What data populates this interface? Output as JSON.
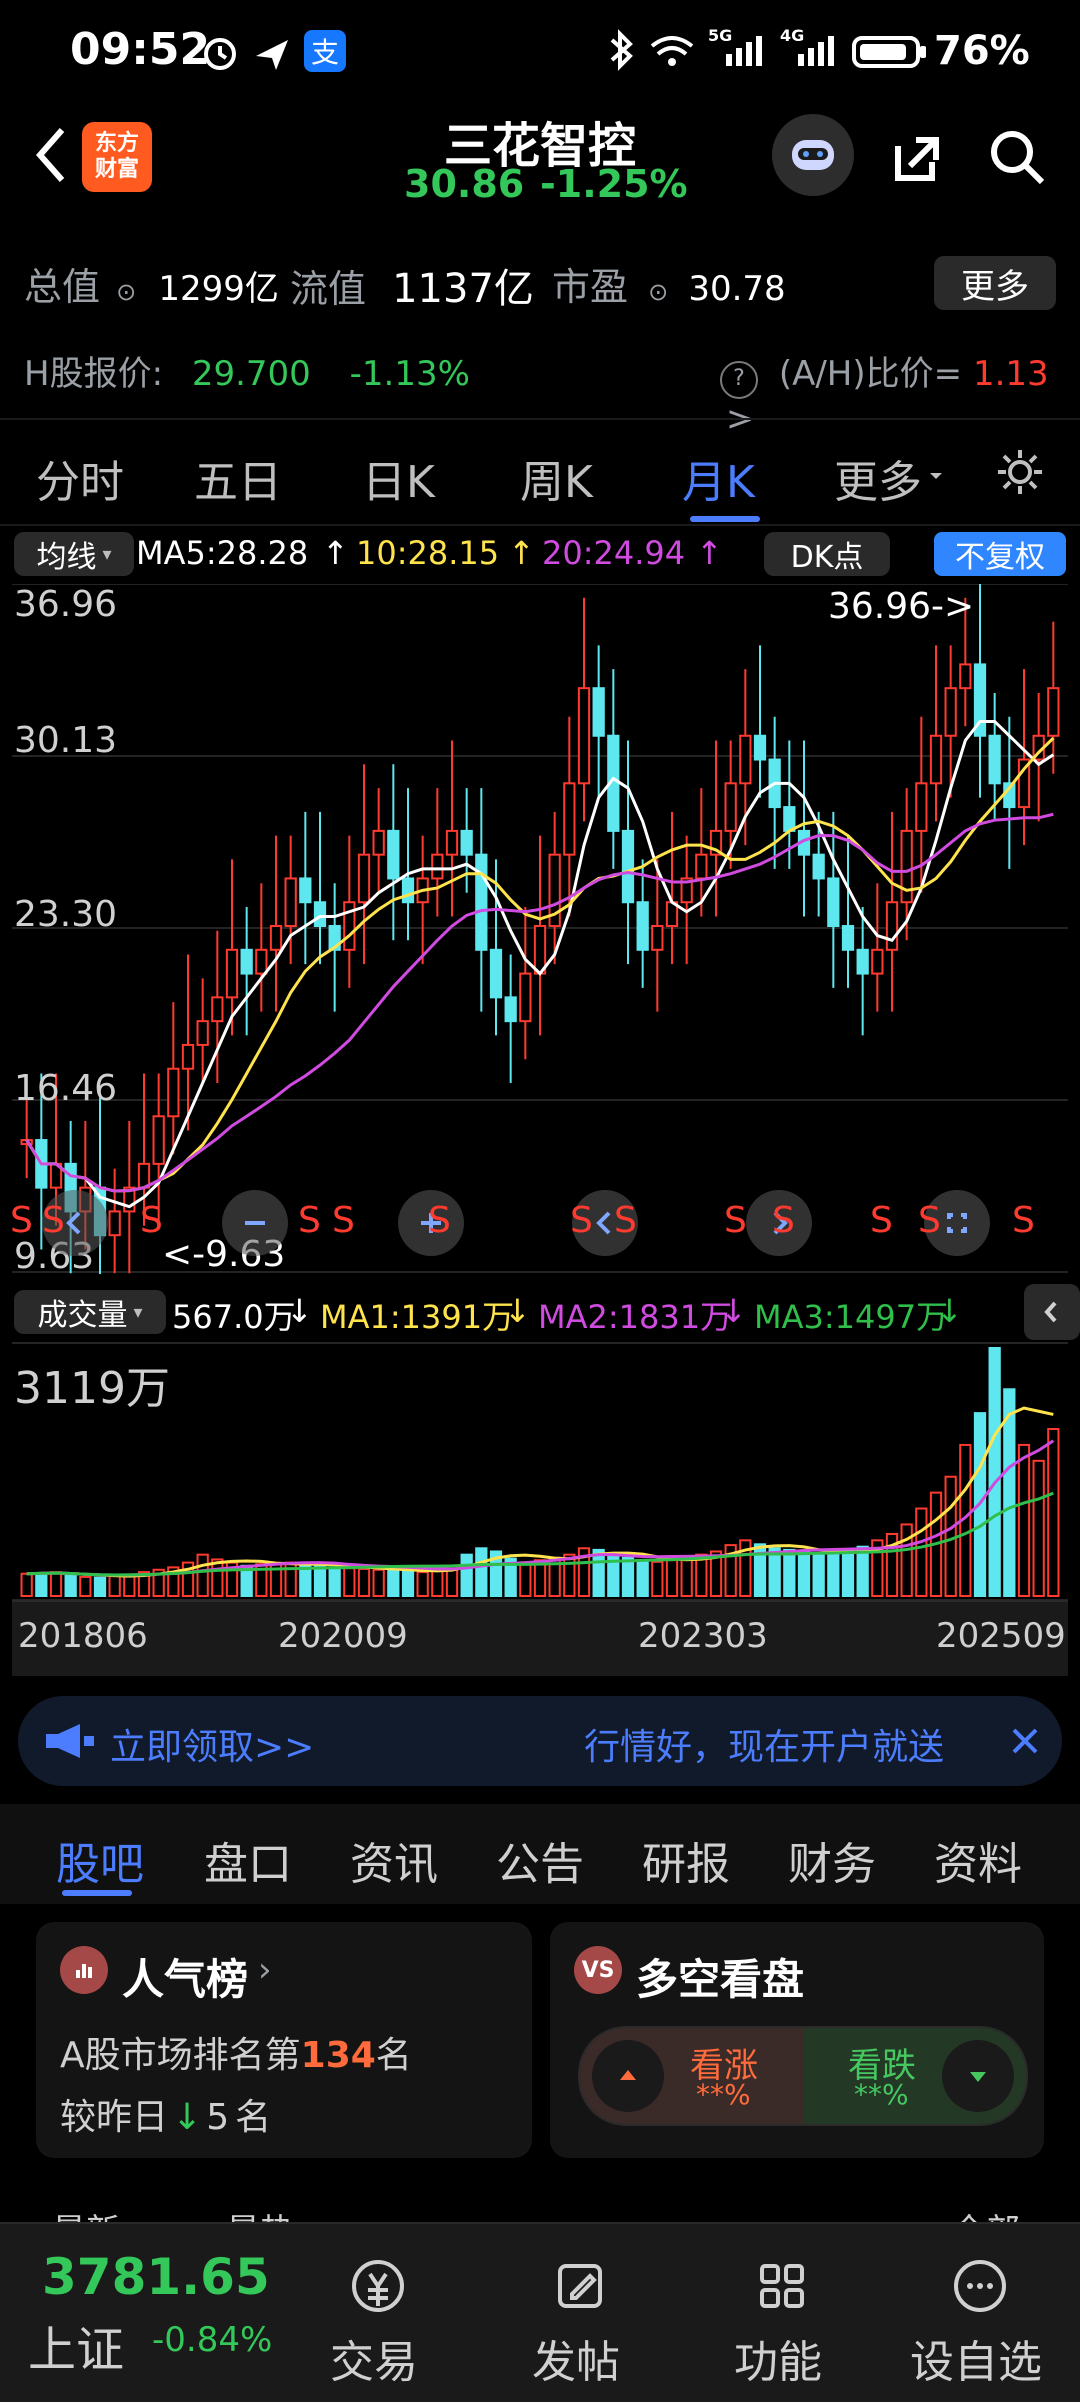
{
  "status_bar": {
    "time": "09:52",
    "battery": "76%",
    "net1": "5G",
    "net2": "4G"
  },
  "header": {
    "app_logo": "东方\n财富",
    "stock_name": "三花智控",
    "price": "30.86",
    "change_pct": "-1.25%"
  },
  "stats": {
    "total_value_label": "总值",
    "total_value": "1299亿",
    "float_value_label": "流值",
    "float_value": "1137亿",
    "pe_label": "市盈",
    "pe_value": "30.78",
    "more_label": "更多",
    "h_label": "H股报价:",
    "h_price": "29.700",
    "h_change": "-1.13%",
    "ah_label": "(A/H)比价=",
    "ah_value": "1.13"
  },
  "tabs": {
    "items": [
      "分时",
      "五日",
      "日K",
      "周K",
      "月K",
      "更多"
    ],
    "active_index": 4
  },
  "ma_row": {
    "btn": "均线",
    "ma5": "MA5:28.28",
    "ma10": "10:28.15",
    "ma20": "20:24.94",
    "dk": "DK点",
    "adj": "不复权"
  },
  "chart_main": {
    "y_ticks": [
      "36.96",
      "30.13",
      "23.30",
      "16.46",
      "9.63"
    ],
    "high_annotation": "36.96->",
    "low_annotation": "<-9.63"
  },
  "vol_row": {
    "btn": "成交量",
    "vol": "567.0万",
    "ma1": "MA1:1391万",
    "ma2": "MA2:1831万",
    "ma3": "MA3:1497万"
  },
  "chart_vol": {
    "y_max": "3119万",
    "x_ticks": [
      "201806",
      "202009",
      "202303",
      "202509"
    ]
  },
  "promo": {
    "left": "立即领取>>",
    "right": "行情好，现在开户就送"
  },
  "bottom_tabs": {
    "items": [
      "股吧",
      "盘口",
      "资讯",
      "公告",
      "研报",
      "财务",
      "资料"
    ],
    "active_index": 0
  },
  "popularity": {
    "title": "人气榜",
    "line1_prefix": "A股市场排名第",
    "rank": "134",
    "line1_suffix": "名",
    "line2_prefix": "较昨日",
    "delta": "5",
    "line2_suffix": "名"
  },
  "sentiment": {
    "title": "多空看盘",
    "up_label": "看涨",
    "up_value": "**%",
    "down_label": "看跌",
    "down_value": "**%"
  },
  "footer": {
    "index_value": "3781.65",
    "index_name": "上证",
    "index_change": "-0.84%",
    "trade": "交易",
    "post": "发帖",
    "func": "功能",
    "watch": "设自选"
  },
  "partial_row": {
    "left": "最新",
    "mid": "最热",
    "right": "全部"
  },
  "chart_data": {
    "type": "candlestick",
    "xlabels": [
      "201806",
      "202009",
      "202303",
      "202509"
    ],
    "price_ylim": [
      9.63,
      36.96
    ],
    "price_series": [
      14,
      12,
      13,
      11,
      12,
      10,
      11,
      12,
      13,
      15,
      17,
      18,
      19,
      20,
      22,
      21,
      22,
      23,
      25,
      24,
      23,
      22,
      24,
      26,
      27,
      25,
      24,
      25,
      26,
      27,
      26,
      22,
      20,
      19,
      21,
      23,
      26,
      29,
      33,
      31,
      27,
      24,
      22,
      23,
      24,
      25,
      26,
      27,
      29,
      31,
      30,
      28,
      27,
      26,
      25,
      23,
      22,
      21,
      22,
      24,
      27,
      29,
      31,
      33,
      34,
      31,
      29,
      28,
      30,
      31,
      33
    ],
    "volume_ylim": [
      0,
      3119
    ],
    "volume_series": [
      280,
      290,
      300,
      260,
      240,
      230,
      250,
      270,
      300,
      330,
      360,
      420,
      520,
      460,
      420,
      380,
      400,
      410,
      420,
      390,
      380,
      360,
      350,
      340,
      330,
      320,
      310,
      300,
      320,
      380,
      520,
      600,
      560,
      470,
      420,
      450,
      480,
      520,
      600,
      580,
      520,
      480,
      450,
      430,
      450,
      470,
      520,
      560,
      640,
      700,
      650,
      600,
      580,
      560,
      520,
      520,
      560,
      620,
      700,
      780,
      900,
      1100,
      1300,
      1500,
      1900,
      2300,
      3119,
      2600,
      1900,
      1700,
      2100
    ]
  }
}
